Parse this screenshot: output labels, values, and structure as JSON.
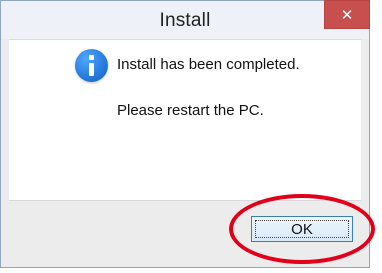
{
  "window": {
    "title": "Install",
    "close_glyph": "✕"
  },
  "message": {
    "icon": "info-icon",
    "line1": "Install has been completed.",
    "line2": "Please restart the PC."
  },
  "buttons": {
    "ok_label": "OK"
  },
  "colors": {
    "close_button": "#c7504f",
    "info_icon": "#2a7de0",
    "highlight_ring": "#e1001a"
  }
}
